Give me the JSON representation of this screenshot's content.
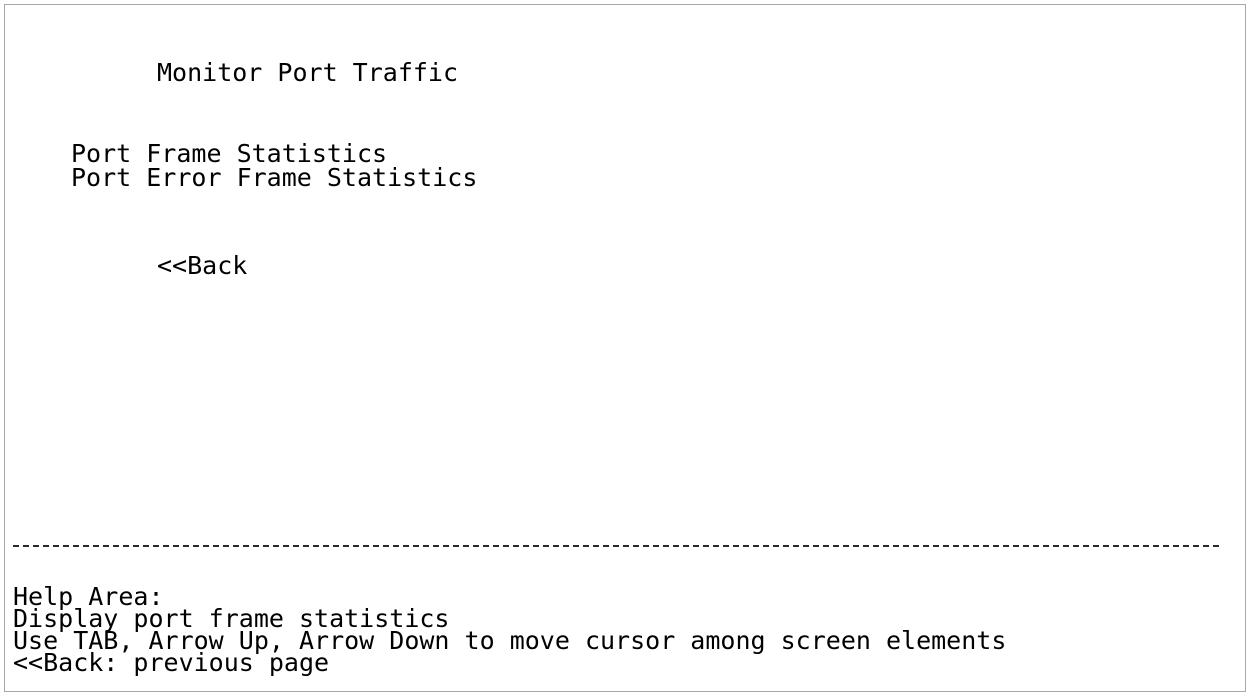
{
  "screen": {
    "title": "Monitor Port Traffic",
    "menu": [
      {
        "label": "Port Frame Statistics"
      },
      {
        "label": "Port Error Frame Statistics"
      }
    ],
    "back_label": "<<Back"
  },
  "help": {
    "title": "Help Area:",
    "lines": [
      "Display port frame statistics",
      "Use TAB, Arrow Up, Arrow Down to move cursor among screen elements",
      "<<Back: previous page"
    ]
  }
}
